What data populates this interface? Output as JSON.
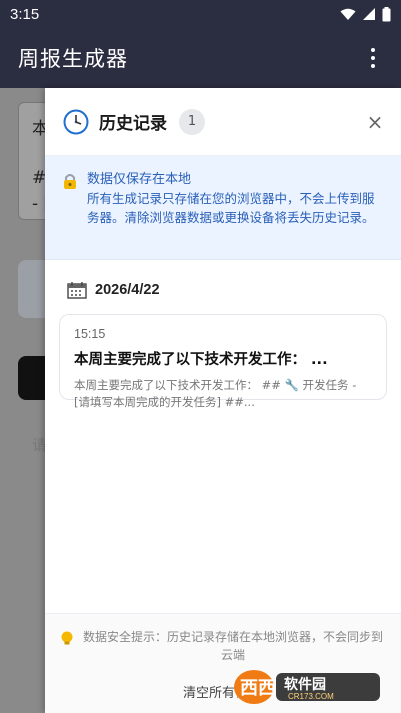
{
  "status_bar": {
    "time": "3:15"
  },
  "app_bar": {
    "title": "周报生成器"
  },
  "background": {
    "card_char": "本",
    "hash": "#",
    "dash": "- [",
    "faint_char": "请"
  },
  "drawer": {
    "title": "历史记录",
    "count": "1",
    "close_symbol": "×",
    "notice": {
      "title": "数据仅保存在本地",
      "body": "所有生成记录只存储在您的浏览器中，不会上传到服务器。清除浏览器数据或更换设备将丢失历史记录。"
    },
    "group": {
      "date": "2026/4/22",
      "records": [
        {
          "time": "15:15",
          "title": "本周主要完成了以下技术开发工作： ...",
          "preview": "本周主要完成了以下技术开发工作： ## 🔧 开发任务 - [请填写本周完成的开发任务] ##..."
        }
      ]
    },
    "footer": {
      "safety_tip": "数据安全提示：历史记录存储在本地浏览器，不会同步到云端",
      "clear_label": "清空所有记录"
    }
  },
  "watermark": {
    "brand": "西西",
    "tag": "软件园",
    "url": "CR173.COM"
  },
  "colors": {
    "app_bar": "#2b2d40",
    "notice_bg": "#eaf3ff",
    "notice_text": "#2a5fb8"
  }
}
